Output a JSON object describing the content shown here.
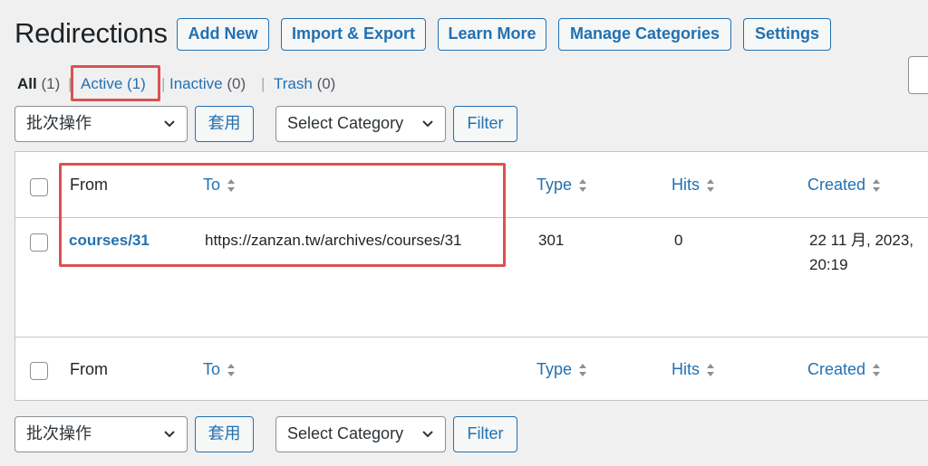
{
  "header": {
    "title": "Redirections",
    "buttons": [
      "Add New",
      "Import & Export",
      "Learn More",
      "Manage Categories",
      "Settings"
    ]
  },
  "views": {
    "all": {
      "label": "All",
      "count": "(1)"
    },
    "active": {
      "label": "Active",
      "count": "(1)"
    },
    "inactive": {
      "label": "Inactive",
      "count": "(0)"
    },
    "trash": {
      "label": "Trash",
      "count": "(0)"
    },
    "separator": "|"
  },
  "tablenav": {
    "bulk_action": "批次操作",
    "apply": "套用",
    "category": "Select Category",
    "filter": "Filter"
  },
  "table": {
    "columns": {
      "from": "From",
      "to": "To",
      "type": "Type",
      "hits": "Hits",
      "created": "Created"
    },
    "rows": [
      {
        "from": "courses/31",
        "to": "https://zanzan.tw/archives/courses/31",
        "type": "301",
        "hits": "0",
        "created_line1": "22 11 月, 2023,",
        "created_line2": "20:19"
      }
    ]
  },
  "colors": {
    "accent": "#2271b1",
    "highlight": "#d9534f",
    "background": "#f0f0f1"
  }
}
